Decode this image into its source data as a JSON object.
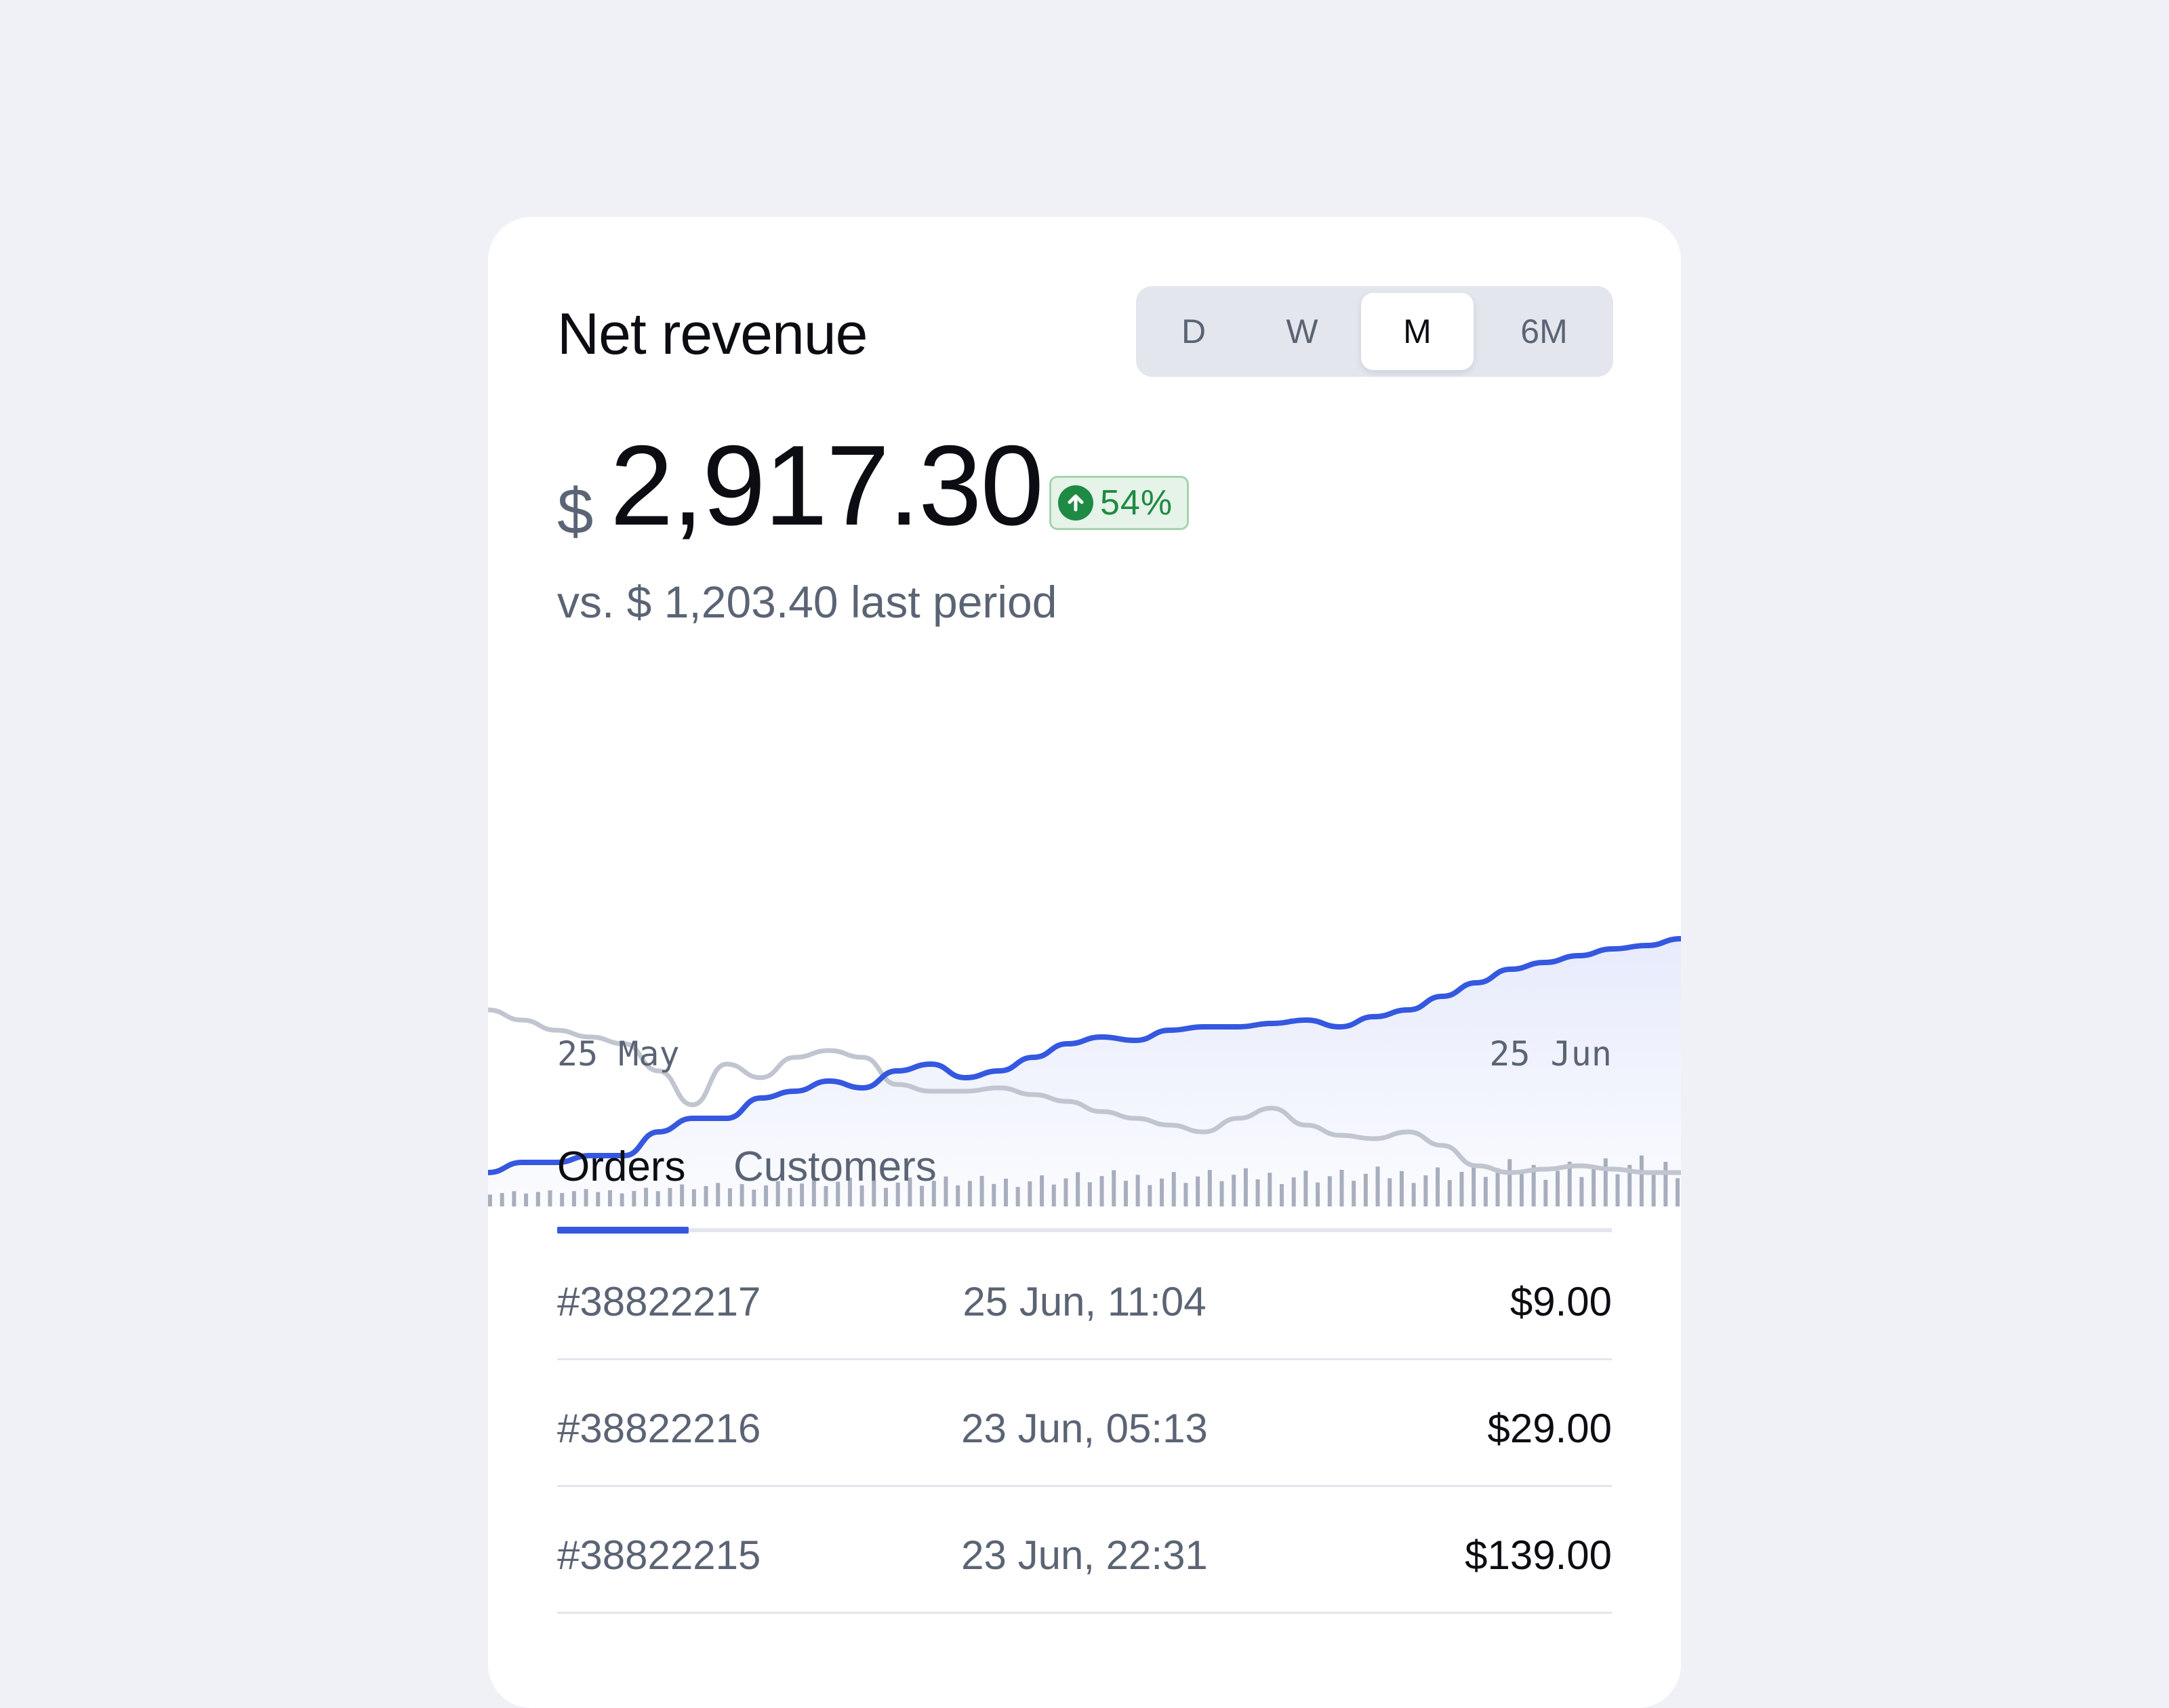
{
  "widget": {
    "title": "Net revenue",
    "periods": [
      {
        "label": "D",
        "active": false
      },
      {
        "label": "W",
        "active": false
      },
      {
        "label": "M",
        "active": true
      },
      {
        "label": "6M",
        "active": false
      }
    ],
    "currency_symbol": "$",
    "amount": "2,917.30",
    "change_badge": {
      "text": "54%",
      "direction": "up",
      "icon": "arrow-up-circle-icon",
      "color": "#1f8a43"
    },
    "comparison": "vs. $ 1,203.40 last period"
  },
  "chart_data": {
    "type": "line",
    "x_start_label": "25 May",
    "x_end_label": "25 Jun",
    "series": [
      {
        "color": "#3558e0",
        "values": [
          10,
          13,
          13,
          15,
          15,
          22,
          26,
          26,
          32,
          34,
          37,
          35,
          40,
          42,
          38,
          40,
          44,
          48,
          50,
          49,
          52,
          53,
          53,
          54,
          55,
          53,
          56,
          58,
          62,
          66,
          70,
          72,
          74,
          76,
          77,
          79
        ]
      },
      {
        "color": "#c0c5cf",
        "values": [
          58,
          55,
          52,
          50,
          48,
          40,
          30,
          42,
          38,
          44,
          46,
          44,
          36,
          34,
          34,
          35,
          33,
          31,
          28,
          26,
          24,
          22,
          26,
          29,
          24,
          21,
          20,
          22,
          18,
          12,
          10,
          11,
          12,
          11,
          10,
          10
        ]
      }
    ],
    "blue_line_color": "#3558e0",
    "grey_line_color": "#c0c5cf",
    "volume_bar_color": "#aab0bc"
  },
  "tabs": [
    {
      "label": "Orders",
      "active": true
    },
    {
      "label": "Customers",
      "active": false
    }
  ],
  "orders": [
    {
      "id": "#38822217",
      "date": "25 Jun, 11:04",
      "amount": "$9.00"
    },
    {
      "id": "#38822216",
      "date": "23 Jun, 05:13",
      "amount": "$29.00"
    },
    {
      "id": "#38822215",
      "date": "23 Jun, 22:31",
      "amount": "$139.00"
    }
  ],
  "colors": {
    "accent": "#3558e0",
    "text": "#0b0d12",
    "muted": "#5b6474",
    "page_bg": "#eff1f6"
  }
}
